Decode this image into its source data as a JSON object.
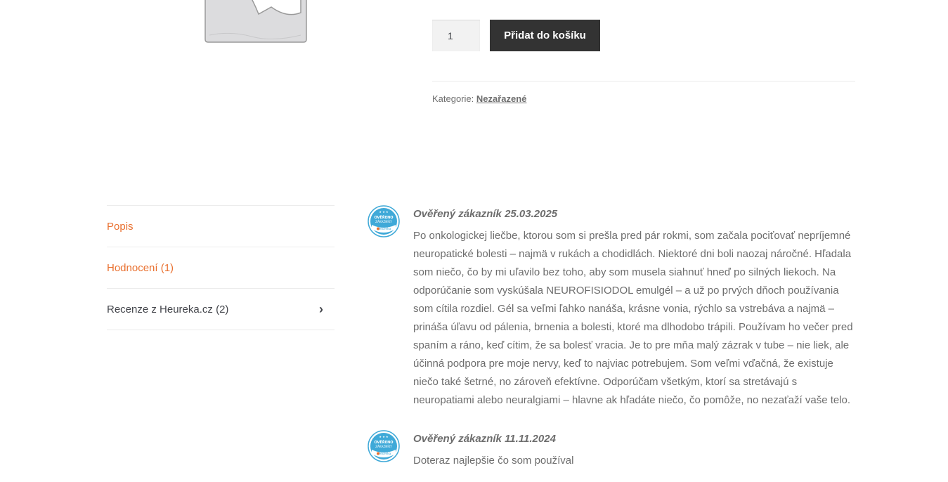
{
  "product": {
    "quantity": "1",
    "add_to_cart_label": "Přidat do košíku",
    "category_label": "Kategorie:",
    "category_value": "Nezařazené"
  },
  "tabs": [
    {
      "label": "Popis"
    },
    {
      "label": "Hodnocení (1)"
    },
    {
      "label": "Recenze z Heureka.cz (2)"
    }
  ],
  "reviews": [
    {
      "author": "Ověřený zákazník 25.03.2025",
      "text": "Po onkologickej liečbe, ktorou som si prešla pred pár rokmi, som začala pociťovať nepríjemné neuropatické bolesti – najmä v rukách a chodidlách. Niektoré dni boli naozaj náročné. Hľadala som niečo, čo by mi uľavilo bez toho, aby som musela siahnuť hneď po silných liekoch. Na odporúčanie som vyskúšala NEUROFISIODOL emulgél – a už po prvých dňoch používania som cítila rozdiel. Gél sa veľmi ľahko nanáša, krásne vonia, rýchlo sa vstrebáva a najmä – prináša úľavu od pálenia, brnenia a bolesti, ktoré ma dlhodobo trápili. Používam ho večer pred spaním a ráno, keď cítim, že sa bolesť vracia. Je to pre mňa malý zázrak v tube – nie liek, ale účinná podpora pre moje nervy, keď to najviac potrebujem. Som veľmi vďačná, že existuje niečo také šetrné, no zároveň efektívne. Odporúčam všetkým, ktorí sa stretávajú s neuropatiami alebo neuralgiami – hlavne ak hľadáte niečo, čo pomôže, no nezaťaží vaše telo."
    },
    {
      "author": "Ověřený zákazník 11.11.2024",
      "text": "Doteraz najlepšie čo som používal"
    }
  ],
  "badge": {
    "line1": "OVĚŘENO",
    "line2": "ZÁKAZNÍKY",
    "brand": "Heureka"
  },
  "colors": {
    "accent": "#e9702f",
    "button_bg": "#333333",
    "badge_blue": "#3fa9d8",
    "text": "#6d6d6d"
  },
  "icons": {
    "tab_chevron": "chevron-right-icon",
    "badge": "heureka-verified-badge-icon"
  }
}
